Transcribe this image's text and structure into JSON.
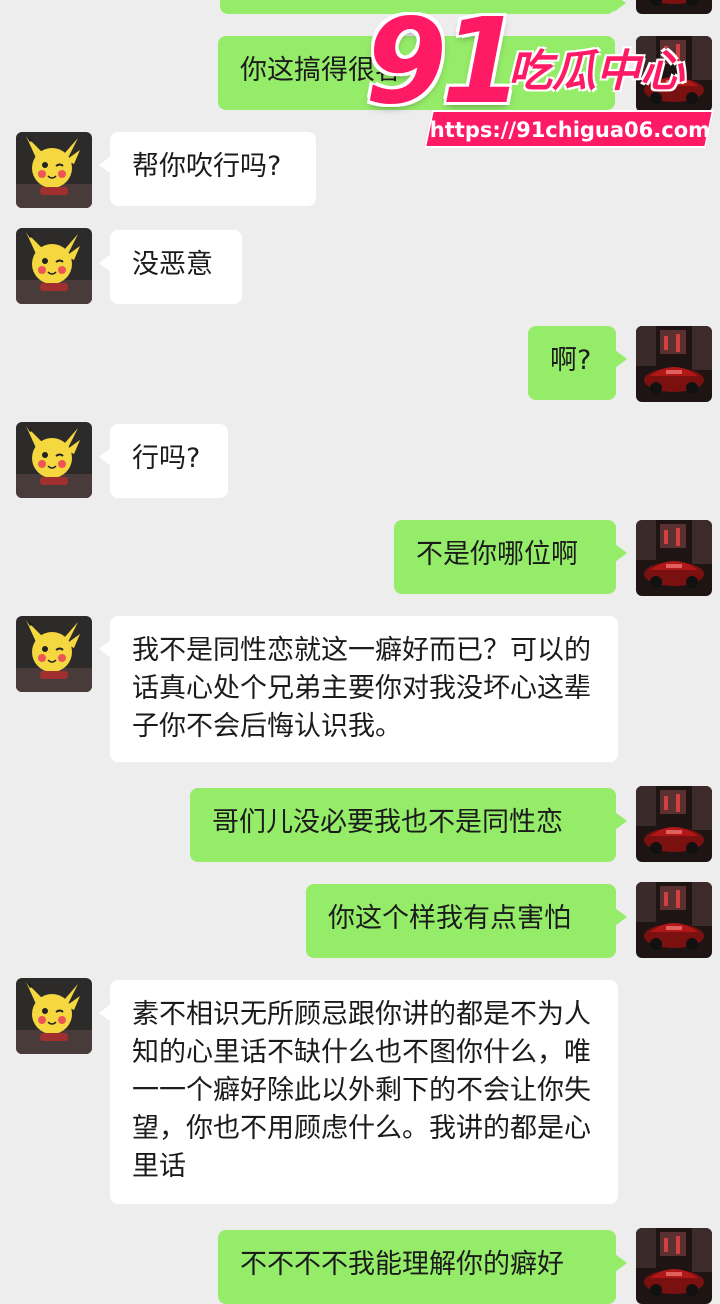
{
  "messages": [
    {
      "side": "me",
      "text": ""
    },
    {
      "side": "me",
      "text": "你这搞得很客气"
    },
    {
      "side": "other",
      "text": "帮你吹行吗?"
    },
    {
      "side": "other",
      "text": "没恶意"
    },
    {
      "side": "me",
      "text": "啊?"
    },
    {
      "side": "other",
      "text": "行吗?"
    },
    {
      "side": "me",
      "text": "不是你哪位啊"
    },
    {
      "side": "other",
      "text": "我不是同性恋就这一癖好而已？可以的话真心处个兄弟主要你对我没坏心这辈子你不会后悔认识我。"
    },
    {
      "side": "me",
      "text": "哥们儿没必要我也不是同性恋"
    },
    {
      "side": "me",
      "text": "你这个样我有点害怕"
    },
    {
      "side": "other",
      "text": "素不相识无所顾忌跟你讲的都是不为人知的心里话不缺什么也不图你什么，唯一一个癖好除此以外剩下的不会让你失望，你也不用顾虑什么。我讲的都是心里话"
    },
    {
      "side": "me",
      "text": "不不不不我能理解你的癖好"
    }
  ],
  "watermark": {
    "number": "91",
    "title": "吃瓜中心",
    "url": "https://91chigua06.com"
  },
  "icons": {
    "other_avatar": "pikachu-avatar-icon",
    "me_avatar": "red-car-avatar-icon"
  },
  "colors": {
    "background": "#ededed",
    "my_bubble": "#95ec69",
    "their_bubble": "#ffffff",
    "watermark": "#ff1a66"
  }
}
